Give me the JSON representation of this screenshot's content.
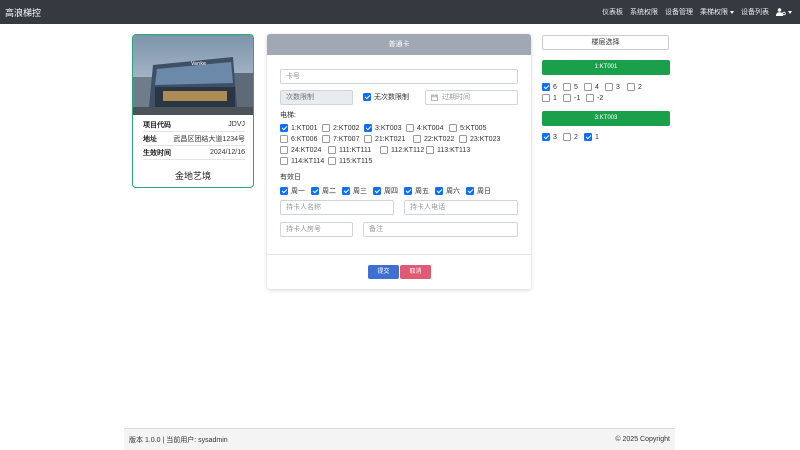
{
  "navbar": {
    "brand": "高浪梯控",
    "items": [
      {
        "label": "仪表板"
      },
      {
        "label": "系统权限"
      },
      {
        "label": "设备管理"
      },
      {
        "label": "乘梯权限"
      },
      {
        "label": "设备列表"
      }
    ]
  },
  "project": {
    "logo_text": "Vanke",
    "rows": [
      {
        "key": "项目代码",
        "value": "JDVJ"
      },
      {
        "key": "地址",
        "value": "武昌区团结大道1234号"
      },
      {
        "key": "生效时间",
        "value": "2024/12/16"
      }
    ],
    "name": "金地艺境"
  },
  "form": {
    "title": "普通卡",
    "card_no_placeholder": "卡号",
    "count_limit_placeholder": "次数限制",
    "unlimited_label": "无次数限制",
    "expire_placeholder": "过期时间",
    "elevator_label": "电梯:",
    "elevators": [
      {
        "label": "1:KT001",
        "checked": true
      },
      {
        "label": "2:KT002",
        "checked": false
      },
      {
        "label": "3:KT003",
        "checked": true
      },
      {
        "label": "4:KT004",
        "checked": false
      },
      {
        "label": "5:KT005",
        "checked": false
      },
      {
        "label": "6:KT006",
        "checked": false
      },
      {
        "label": "7:KT007",
        "checked": false
      },
      {
        "label": "21:KT021",
        "checked": false
      },
      {
        "label": "22:KT022",
        "checked": false
      },
      {
        "label": "23:KT023",
        "checked": false
      },
      {
        "label": "24:KT024",
        "checked": false
      },
      {
        "label": "111:KT111",
        "checked": false
      },
      {
        "label": "112:KT112",
        "checked": false
      },
      {
        "label": "113:KT113",
        "checked": false
      },
      {
        "label": "114:KT114",
        "checked": false
      },
      {
        "label": "115:KT115",
        "checked": false
      }
    ],
    "weekday_label": "有效日",
    "weekdays": [
      {
        "label": "周一",
        "checked": true
      },
      {
        "label": "周二",
        "checked": true
      },
      {
        "label": "周三",
        "checked": true
      },
      {
        "label": "周四",
        "checked": true
      },
      {
        "label": "周五",
        "checked": true
      },
      {
        "label": "周六",
        "checked": true
      },
      {
        "label": "周日",
        "checked": true
      }
    ],
    "holder_name_placeholder": "持卡人名称",
    "holder_phone_placeholder": "持卡人电话",
    "holder_room_placeholder": "持卡人房号",
    "remark_placeholder": "备注",
    "submit_label": "提交",
    "cancel_label": "取消"
  },
  "floors": {
    "select_label": "楼层选择",
    "groups": [
      {
        "title": "1:KT001",
        "items": [
          {
            "label": "6",
            "checked": true
          },
          {
            "label": "5",
            "checked": false
          },
          {
            "label": "4",
            "checked": false
          },
          {
            "label": "3",
            "checked": false
          },
          {
            "label": "2",
            "checked": false
          },
          {
            "label": "1",
            "checked": false
          },
          {
            "label": "-1",
            "checked": false
          },
          {
            "label": "-2",
            "checked": false
          }
        ]
      },
      {
        "title": "3:KT003",
        "items": [
          {
            "label": "3",
            "checked": true
          },
          {
            "label": "2",
            "checked": false
          },
          {
            "label": "1",
            "checked": true
          }
        ]
      }
    ]
  },
  "footer": {
    "left": "版本 1.0.0 | 当前用户: sysadmin",
    "right": "© 2025 Copyright"
  },
  "colors": {
    "navbar": "#343a40",
    "accent_blue": "#0d6efd",
    "green": "#1aa04a",
    "card_border": "#2aa774",
    "submit": "#3f6fd1",
    "cancel": "#e05a73",
    "form_header": "#9fa8b3"
  }
}
